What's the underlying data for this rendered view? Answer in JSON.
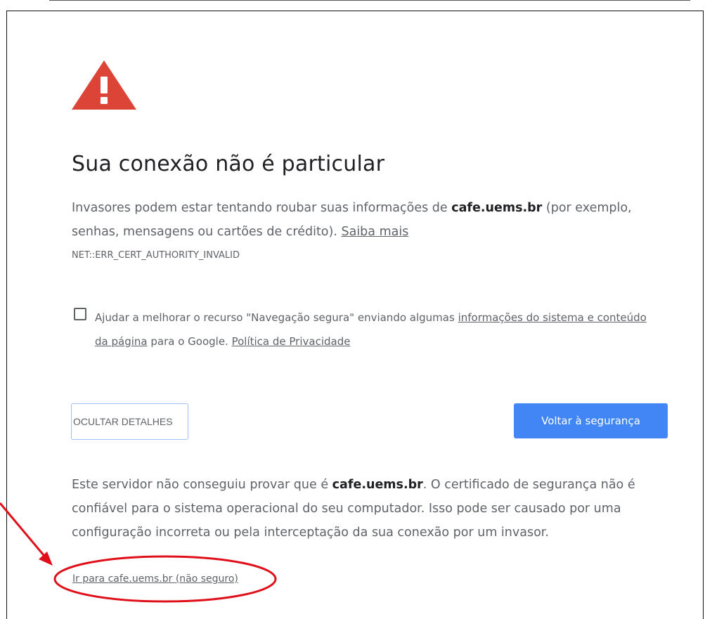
{
  "heading": "Sua conexão não é particular",
  "intro": {
    "text_before": "Invasores podem estar tentando roubar suas informações de ",
    "host": "cafe.uems.br",
    "text_after": " (por exemplo, senhas, mensagens ou cartões de crédito). ",
    "learn_more": "Saiba mais"
  },
  "error_code": "NET::ERR_CERT_AUTHORITY_INVALID",
  "safe_browsing_opt_in": {
    "checked": false,
    "text_before": "Ajudar a melhorar o recurso \"Navegação segura\" enviando algumas ",
    "link_system_info": "informações do sistema e conteúdo da página",
    "text_middle": " para o Google. ",
    "link_privacy": "Política de Privacidade"
  },
  "buttons": {
    "hide_details": "OCULTAR DETALHES",
    "back_to_safety": "Voltar à segurança"
  },
  "details": {
    "text_before": "Este servidor não conseguiu provar que é ",
    "host": "cafe.uems.br",
    "text_after": ". O certificado de segurança não é confiável para o sistema operacional do seu computador. Isso pode ser causado por uma configuração incorreta ou pela interceptação da sua conexão por um invasor."
  },
  "proceed_link": "Ir para cafe.uems.br (não seguro)",
  "colors": {
    "warning_icon": "#db4437",
    "primary_button": "#4285f4",
    "annotation": "#e0101a",
    "body_text": "#5f6368",
    "heading_text": "#202124"
  },
  "icons": {
    "warning": "warning-triangle-icon",
    "checkbox": "checkbox-unchecked"
  }
}
